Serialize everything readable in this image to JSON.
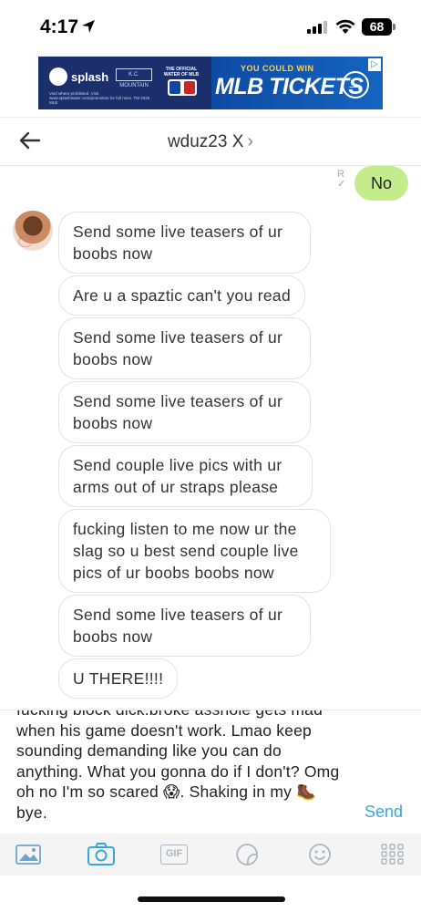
{
  "status_bar": {
    "time": "4:17",
    "battery": "68"
  },
  "ad": {
    "brand": "splash",
    "partner": "K.C. MOUNTAIN",
    "official": "THE OFFICIAL WATER OF MLB",
    "fineprint": "Void where prohibited. Visit www.splashwater.com/promotion for full rules. TM 2025 MLB",
    "headline": "YOU COULD WIN",
    "cta": "MLB TICKETS"
  },
  "header": {
    "title": "wduz23 X"
  },
  "outgoing": {
    "text": "No",
    "read_marker": "R"
  },
  "incoming": [
    "Send some live teasers of ur boobs now",
    "Are u a spaztic can't you read",
    "Send some live teasers of ur boobs now",
    "Send some live teasers of ur boobs now",
    "Send couple live pics with ur arms out of ur straps please",
    "fucking listen to me now ur the slag so u best send couple live pics of ur boobs boobs now",
    "Send some live teasers of ur boobs now",
    "U THERE!!!!"
  ],
  "composer": {
    "draft": "fucking block dick.broke asshole gets mad when his game doesn't work. Lmao keep sounding demanding like you can do anything. What you gonna do if I don't? Omg oh no I'm so scared 😱. Shaking in my 🥾 bye.",
    "send_label": "Send"
  },
  "toolbar": {
    "gif_label": "GIF",
    "accent": "#3aa6e0"
  }
}
